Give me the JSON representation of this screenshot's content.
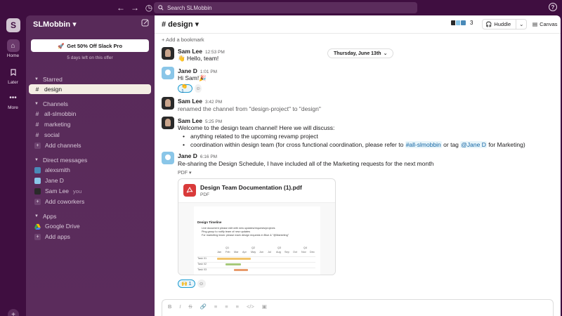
{
  "topbar": {
    "back": "←",
    "forward": "→",
    "history": "◷",
    "search_placeholder": "Search SLMobbin",
    "help": "?"
  },
  "rail": {
    "workspace_initial": "S",
    "home_label": "Home",
    "later_label": "Later",
    "more_label": "More",
    "add": "+"
  },
  "sidebar": {
    "workspace_name": "SLMobbin",
    "promo_button": "Get 50% Off Slack Pro",
    "promo_note": "5 days left on this offer",
    "starred_label": "Starred",
    "starred": [
      {
        "name": "design"
      }
    ],
    "channels_label": "Channels",
    "channels": [
      {
        "name": "all-slmobbin"
      },
      {
        "name": "marketing"
      },
      {
        "name": "social"
      }
    ],
    "add_channels": "Add channels",
    "dm_label": "Direct messages",
    "dms": [
      {
        "name": "alexsmith",
        "color": "#4a8ab8"
      },
      {
        "name": "Jane D",
        "color": "#8ac6e8"
      },
      {
        "name": "Sam Lee",
        "color": "#2a2a2a",
        "suffix": "you"
      }
    ],
    "add_coworkers": "Add coworkers",
    "apps_label": "Apps",
    "apps": [
      {
        "name": "Google Drive"
      }
    ],
    "add_apps": "Add apps"
  },
  "header": {
    "channel": "# design",
    "member_count": "3",
    "huddle_label": "Huddle",
    "canvas_label": "Canvas",
    "bookmark": "+ Add a bookmark"
  },
  "date_divider": "Thursday, June 13th",
  "messages": [
    {
      "author": "Sam Lee",
      "time": "12:53 PM",
      "text": "👋 Hello, team!"
    },
    {
      "author": "Jane D",
      "time": "1:01 PM",
      "text": "Hi Sam!🎉",
      "reaction": "👏 1"
    },
    {
      "author": "Sam Lee",
      "time": "3:42 PM",
      "text": "renamed the channel from \"design-project\" to \"design\""
    },
    {
      "author": "Sam Lee",
      "time": "5:25 PM",
      "text": "Welcome to the design team channel! Here we will discuss:",
      "bullet1": "anything related to the upcoming revamp project",
      "bullet2_pre": "coordination within design team (for cross functional coordination, please refer to",
      "bullet2_link1": "#all-slmobbin",
      "bullet2_mid": "or tag",
      "bullet2_link2": "@Jane D",
      "bullet2_post": "for Marketing)"
    },
    {
      "author": "Jane D",
      "time": "6:16 PM",
      "text": "Re-sharing the Design Schedule, I have included all of the Marketing requests for the next month",
      "reaction": "🙌 1"
    }
  ],
  "file": {
    "label": "PDF ▾",
    "name": "Design Team Documentation (1).pdf",
    "type": "PDF",
    "doc_title": "Design Timeline",
    "doc_lines": [
      "Live document please edit with new updates/requests/projects",
      "Ping group to notify team of new updates",
      "For marketing team: please mark design requests in Blue & \"@Marketing\""
    ],
    "quarters": [
      "Q1",
      "Q2",
      "Q3",
      "Q4"
    ],
    "months": [
      "Jan",
      "Feb",
      "Mar",
      "Apr",
      "May",
      "Jun",
      "Jul",
      "Aug",
      "Sep",
      "Oct",
      "Nov",
      "Dec"
    ],
    "tasks": [
      "Task 01",
      "Task 02",
      "Task 03"
    ]
  },
  "composer": {
    "tools": [
      "B",
      "I",
      "S",
      "🔗",
      "≡",
      "≡",
      "≡",
      "</>",
      "▣"
    ]
  }
}
